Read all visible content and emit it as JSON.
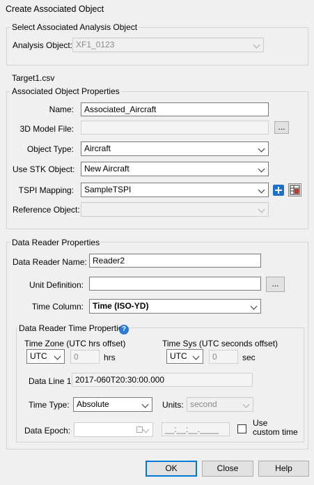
{
  "window": {
    "title": "Create Associated Object"
  },
  "select_group": {
    "title": "Select Associated Analysis Object",
    "analysis_object_label": "Analysis Object:",
    "analysis_object_value": "XF1_0123"
  },
  "file_name": "Target1.csv",
  "properties_group": {
    "title": "Associated Object Properties",
    "name_label": "Name:",
    "name_value": "Associated_Aircraft",
    "model_file_label": "3D Model File:",
    "model_file_value": "",
    "browse_label": "...",
    "object_type_label": "Object Type:",
    "object_type_value": "Aircraft",
    "use_stk_label": "Use STK Object:",
    "use_stk_value": "New Aircraft",
    "tspi_label": "TSPI Mapping:",
    "tspi_value": "SampleTSPI",
    "reference_label": "Reference Object:",
    "reference_value": ""
  },
  "reader_group": {
    "title": "Data Reader Properties",
    "reader_name_label": "Data Reader Name:",
    "reader_name_value": "Reader2",
    "unit_def_label": "Unit Definition:",
    "unit_def_value": "",
    "browse_label": "...",
    "time_column_label": "Time Column:",
    "time_column_value": "Time (ISO-YD)"
  },
  "time_group": {
    "title": "Data Reader Time Properties",
    "time_zone_label": "Time Zone (UTC hrs offset)",
    "time_zone_value": "UTC",
    "time_zone_offset": "0",
    "hrs_label": "hrs",
    "time_sys_label": "Time Sys (UTC seconds offset)",
    "time_sys_value": "UTC",
    "time_sys_offset": "0",
    "sec_label": "sec",
    "data_line_label": "Data Line 1:",
    "data_line_value": "2017-060T20:30:00.000",
    "time_type_label": "Time Type:",
    "time_type_value": "Absolute",
    "units_label": "Units:",
    "units_value": "second",
    "epoch_label": "Data Epoch:",
    "epoch_value": "",
    "custom_time_placeholder": "__:__:__.____",
    "use_custom_line1": "Use",
    "use_custom_line2": "custom time"
  },
  "buttons": {
    "ok": "OK",
    "close": "Close",
    "help": "Help"
  }
}
